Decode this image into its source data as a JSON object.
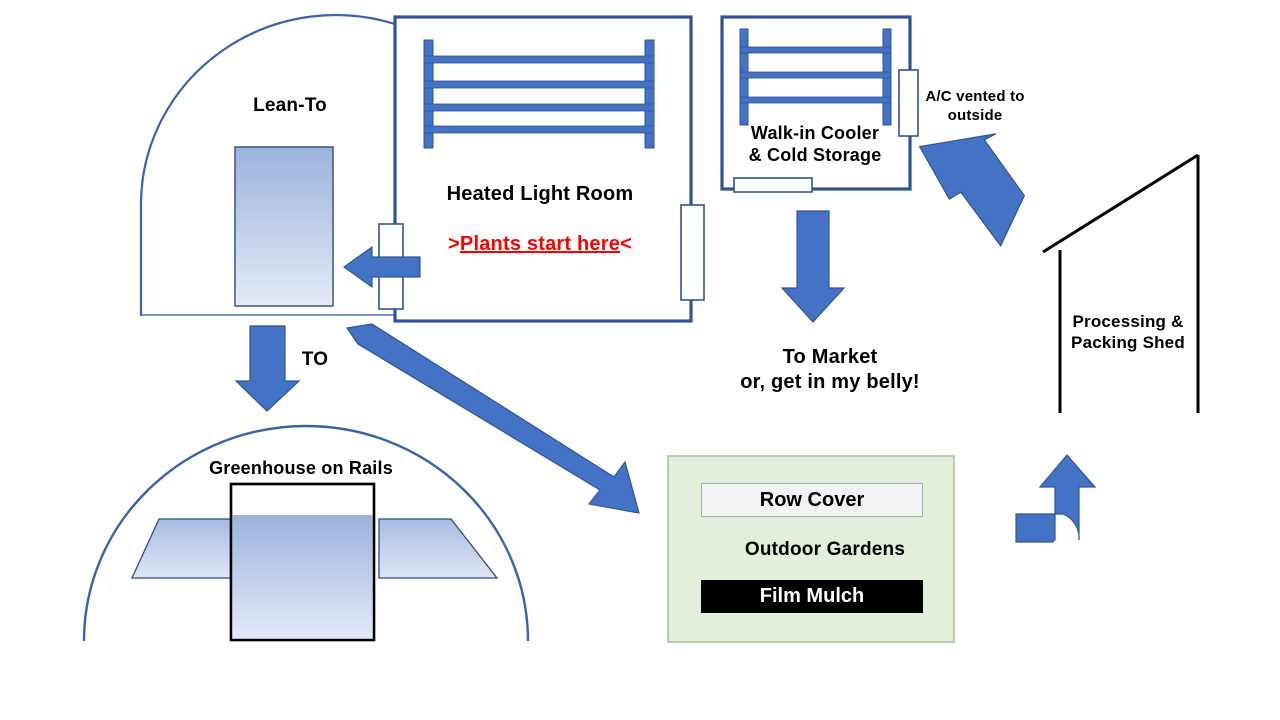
{
  "diagram": {
    "title": "Farm Operations Flow Diagram",
    "background": "#FFFFFF",
    "colors": {
      "arrow_blue": "#4472C4",
      "arrow_blue_edge": "#2E5597",
      "structure_blue": "#2F5496",
      "shelf_blue": "#4472C4",
      "bench_gradient_top": "#9CB3DC",
      "bench_gradient_bottom": "#E3EAF7",
      "garden_green": "#E2EFDA",
      "garden_border": "#A9C4A0",
      "red_text": "#FF0000",
      "black": "#000000",
      "row_cover_fill": "#F2F2F2",
      "film_mulch_fill": "#000000"
    }
  },
  "labels": {
    "lean_to": "Lean-To",
    "heated_light_room": "Heated Light Room",
    "plants_start_prefix": ">",
    "plants_start_text": "Plants start here",
    "plants_start_suffix": "<",
    "walk_in_cooler": "Walk-in Cooler\n& Cold Storage",
    "ac_vented": "A/C vented to\noutside",
    "to": "TO",
    "to_market": "To Market\nor, get in my belly!",
    "processing_shed": "Processing &\nPacking Shed",
    "greenhouse_on_rails": "Greenhouse on Rails",
    "row_cover": "Row Cover",
    "outdoor_gardens": "Outdoor Gardens",
    "film_mulch": "Film Mulch"
  },
  "structures": [
    {
      "name": "lean-to",
      "label": "Lean-To",
      "shape": "quarter-dome",
      "features": [
        "growing-bench"
      ]
    },
    {
      "name": "heated-light-room",
      "label": "Heated Light Room",
      "shape": "rectangle",
      "features": [
        "shelving-rack-4-tier",
        "left-door",
        "right-door"
      ],
      "note": "Plants start here"
    },
    {
      "name": "walk-in-cooler",
      "label": "Walk-in Cooler & Cold Storage",
      "shape": "rectangle",
      "features": [
        "shelving-rack-3-tier",
        "ac-vent-right",
        "bottom-door"
      ]
    },
    {
      "name": "processing-packing-shed",
      "label": "Processing & Packing Shed",
      "shape": "open-sloped-roof"
    },
    {
      "name": "greenhouse-on-rails",
      "label": "Greenhouse on Rails",
      "shape": "dome-with-beds",
      "features": [
        "left-bed",
        "center-house",
        "right-bed"
      ]
    },
    {
      "name": "outdoor-gardens",
      "label": "Outdoor Gardens",
      "shape": "rectangle",
      "features": [
        "row-cover",
        "film-mulch"
      ]
    }
  ],
  "flows": [
    {
      "name": "heated-room-to-lean-to",
      "direction": "left",
      "from": "Heated Light Room",
      "to": "Lean-To"
    },
    {
      "name": "lean-to-to-greenhouse",
      "direction": "down",
      "from": "Lean-To",
      "to": "Greenhouse on Rails",
      "label": "TO"
    },
    {
      "name": "heated-room-to-gardens",
      "direction": "down-right",
      "from": "Heated Light Room",
      "to": "Outdoor Gardens"
    },
    {
      "name": "cooler-to-market",
      "direction": "down",
      "from": "Walk-in Cooler",
      "to": "To Market or, get in my belly!"
    },
    {
      "name": "shed-to-cooler",
      "direction": "up-left",
      "from": "Processing & Packing Shed",
      "to": "Walk-in Cooler"
    },
    {
      "name": "gardens-to-shed",
      "direction": "bent-up",
      "from": "Outdoor Gardens",
      "to": "Processing & Packing Shed"
    }
  ]
}
